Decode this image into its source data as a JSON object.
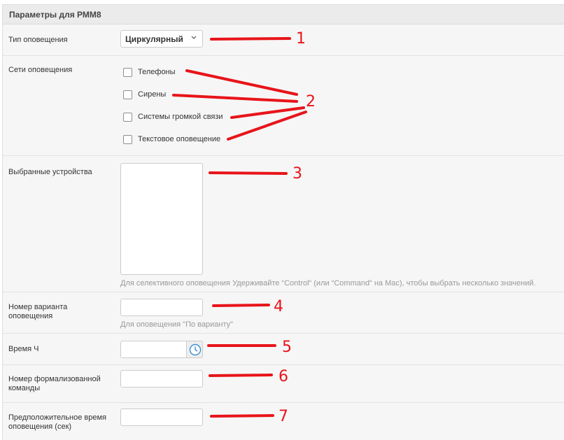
{
  "panel": {
    "title": "Параметры для РММ8"
  },
  "alert_type": {
    "label": "Тип оповещения",
    "selected": "Циркулярный"
  },
  "networks": {
    "label": "Сети оповещения",
    "items": [
      {
        "label": "Телефоны",
        "checked": false
      },
      {
        "label": "Сирены",
        "checked": false
      },
      {
        "label": "Системы громкой связи",
        "checked": false
      },
      {
        "label": "Текстовое оповещение",
        "checked": false
      }
    ]
  },
  "devices": {
    "label": "Выбранные устройства",
    "help": "Для селективного оповещения Удерживайте “Control“ (или “Command“ на Mac), чтобы выбрать несколько значений."
  },
  "variant": {
    "label": "Номер варианта оповещения",
    "value": "",
    "help": "Для оповещения \"По варианту\""
  },
  "time": {
    "label": "Время Ч",
    "value": "",
    "icon": "clock-icon"
  },
  "command": {
    "label": "Номер формализованной команды",
    "value": ""
  },
  "duration": {
    "label": "Предположительное время оповещения (сек)",
    "value": ""
  },
  "annotations": {
    "color": "#e8141a",
    "numbers": [
      "1",
      "2",
      "3",
      "4",
      "5",
      "6",
      "7"
    ]
  }
}
